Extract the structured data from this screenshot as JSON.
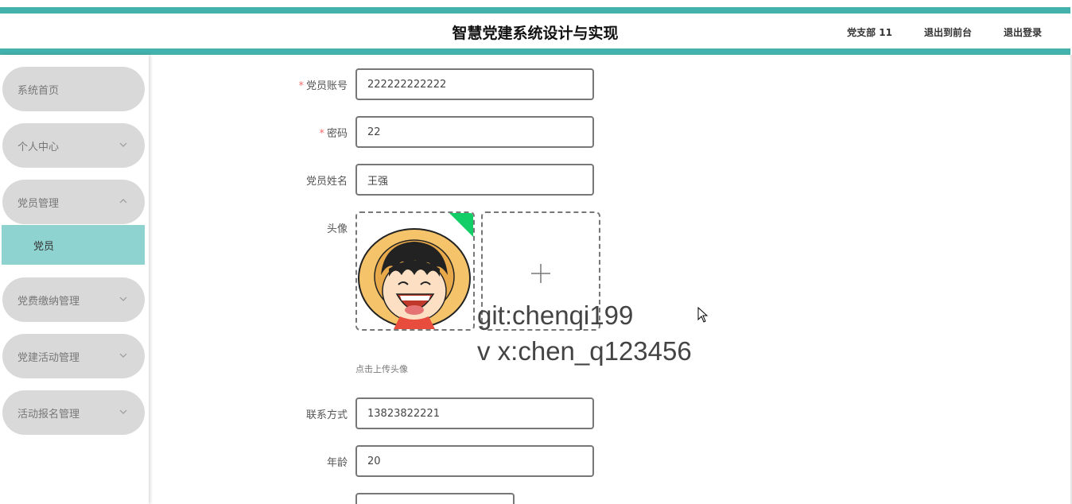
{
  "header": {
    "title": "智慧党建系统设计与实现",
    "user": "党支部 11",
    "back_to_front": "退出到前台",
    "logout": "退出登录"
  },
  "sidebar": {
    "items": [
      {
        "label": "系统首页"
      },
      {
        "label": "个人中心"
      },
      {
        "label": "党员管理"
      },
      {
        "label": "党员"
      },
      {
        "label": "党费缴纳管理"
      },
      {
        "label": "党建活动管理"
      },
      {
        "label": "活动报名管理"
      }
    ]
  },
  "form": {
    "account": {
      "label": "党员账号",
      "value": "222222222222"
    },
    "password": {
      "label": "密码",
      "value": "22"
    },
    "name": {
      "label": "党员姓名",
      "value": "王强"
    },
    "avatar": {
      "label": "头像",
      "hint": "点击上传头像"
    },
    "phone": {
      "label": "联系方式",
      "value": "13823822221"
    },
    "age": {
      "label": "年龄",
      "value": "20"
    }
  },
  "watermark": {
    "line1": "git:chenqi199",
    "line2": "v x:chen_q123456"
  },
  "colors": {
    "accent": "#43b1ac",
    "submenu_active": "#8fd3d0",
    "menu_bg": "#d9d9d9",
    "required": "#f56c6c",
    "upload_badge": "#13ce66"
  }
}
